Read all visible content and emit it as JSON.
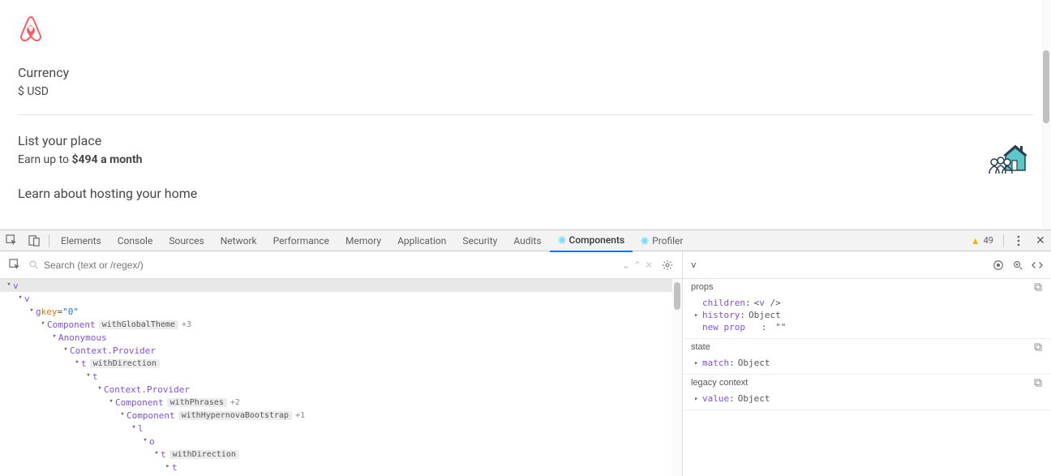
{
  "page": {
    "currency_title": "Currency",
    "currency_value": "$ USD",
    "list_title": "List your place",
    "earn_prefix": "Earn up to ",
    "earn_amount": "$494 a month",
    "learn": "Learn about hosting your home"
  },
  "devtools": {
    "tabs": [
      "Elements",
      "Console",
      "Sources",
      "Network",
      "Performance",
      "Memory",
      "Application",
      "Security",
      "Audits"
    ],
    "ext_tabs": [
      "Components",
      "Profiler"
    ],
    "active_tab": "Components",
    "warn_count": "49"
  },
  "components": {
    "search_placeholder": "Search (text or /regex/)",
    "selected_component": "v",
    "tree": [
      {
        "indent": 0,
        "arrow": "open",
        "name": "v",
        "selected": true
      },
      {
        "indent": 1,
        "arrow": "open",
        "name": "v"
      },
      {
        "indent": 2,
        "arrow": "open",
        "name": "g",
        "attr_key": "key",
        "attr_val": "\"0\""
      },
      {
        "indent": 3,
        "arrow": "open",
        "name": "Component",
        "badge": "withGlobalTheme",
        "plus": "+3"
      },
      {
        "indent": 4,
        "arrow": "open",
        "name": "Anonymous"
      },
      {
        "indent": 5,
        "arrow": "open",
        "name": "Context.Provider"
      },
      {
        "indent": 6,
        "arrow": "open",
        "name": "t",
        "badge": "withDirection"
      },
      {
        "indent": 7,
        "arrow": "open",
        "name": "t"
      },
      {
        "indent": 8,
        "arrow": "open",
        "name": "Context.Provider"
      },
      {
        "indent": 9,
        "arrow": "open",
        "name": "Component",
        "badge": "withPhrases",
        "plus": "+2"
      },
      {
        "indent": 10,
        "arrow": "open",
        "name": "Component",
        "badge": "withHypernovaBootstrap",
        "plus": "+1"
      },
      {
        "indent": 11,
        "arrow": "open",
        "name": "l"
      },
      {
        "indent": 12,
        "arrow": "open",
        "name": "o"
      },
      {
        "indent": 13,
        "arrow": "open",
        "name": "t",
        "badge": "withDirection"
      },
      {
        "indent": 14,
        "arrow": "closed",
        "name": "t"
      }
    ],
    "props_sections": [
      {
        "title": "props",
        "rows": [
          {
            "expand": "",
            "key": "children",
            "val": "<v />",
            "type": "tag"
          },
          {
            "expand": "▸",
            "key": "history",
            "val": "Object",
            "type": "obj"
          },
          {
            "expand": "",
            "key": "new prop",
            "val": "\"\"",
            "type": "str",
            "pad": true
          }
        ]
      },
      {
        "title": "state",
        "rows": [
          {
            "expand": "▸",
            "key": "match",
            "val": "Object",
            "type": "obj"
          }
        ]
      },
      {
        "title": "legacy context",
        "rows": [
          {
            "expand": "▸",
            "key": "value",
            "val": "Object",
            "type": "obj"
          }
        ]
      }
    ]
  }
}
